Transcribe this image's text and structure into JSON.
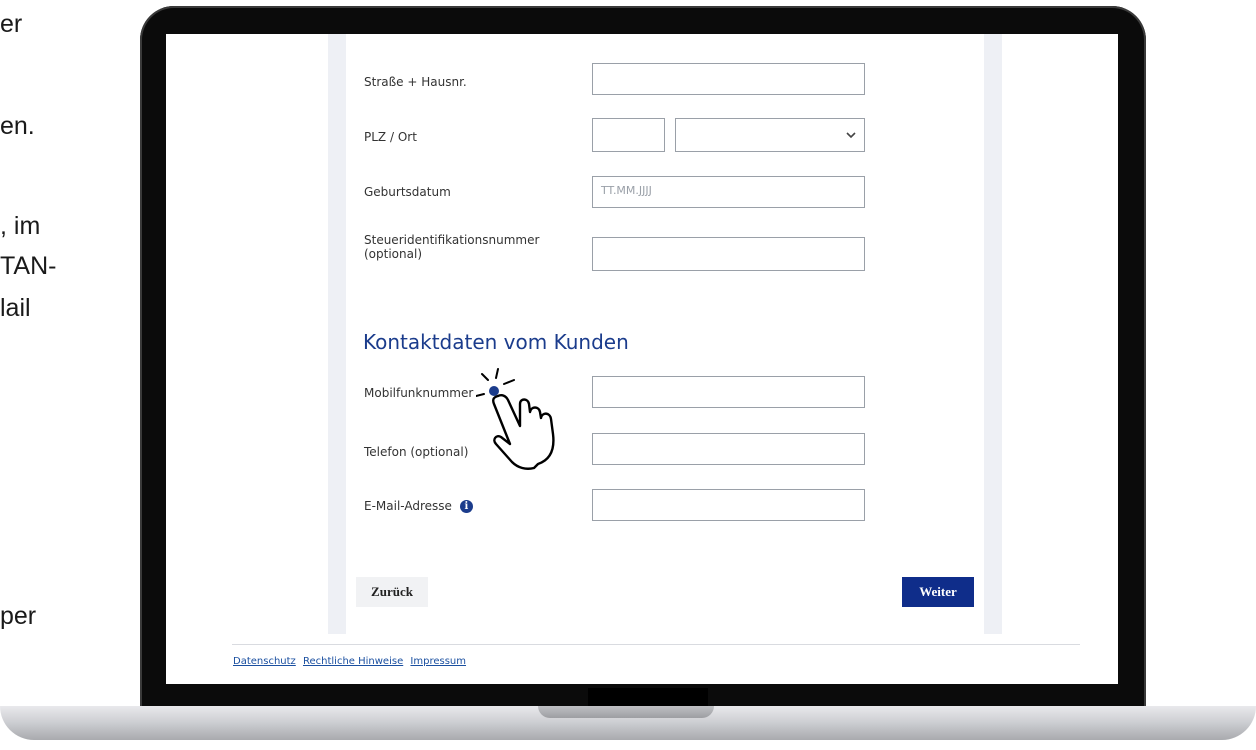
{
  "side_text": [
    "er",
    "en.",
    ", im",
    "TAN-",
    "lail",
    "per"
  ],
  "form": {
    "street_label": "Straße + Hausnr.",
    "street_value": "",
    "plz_label": "PLZ / Ort",
    "plz_value": "",
    "ort_value": "",
    "birth_label": "Geburtsdatum",
    "birth_placeholder": "TT.MM.JJJJ",
    "taxid_label_line1": "Steueridentifikationsnummer",
    "taxid_label_line2": "(optional)",
    "taxid_value": "",
    "contact_title": "Kontaktdaten vom Kunden",
    "mobile_label": "Mobilfunknummer",
    "mobile_value": "",
    "phone_label": "Telefon (optional)",
    "phone_value": "",
    "email_label": "E-Mail-Adresse",
    "email_value": "",
    "info_icon_glyph": "i"
  },
  "buttons": {
    "back": "Zurück",
    "next": "Weiter"
  },
  "footer": {
    "links": [
      "Datenschutz",
      "Rechtliche Hinweise",
      "Impressum"
    ]
  },
  "colors": {
    "accent": "#1b3c8c",
    "primary_button": "#0f2d8a",
    "link": "#1a4fa0"
  },
  "icons": {
    "pointer": "pointing-hand-icon",
    "info": "info-icon",
    "dropdown": "chevron-down-icon"
  }
}
